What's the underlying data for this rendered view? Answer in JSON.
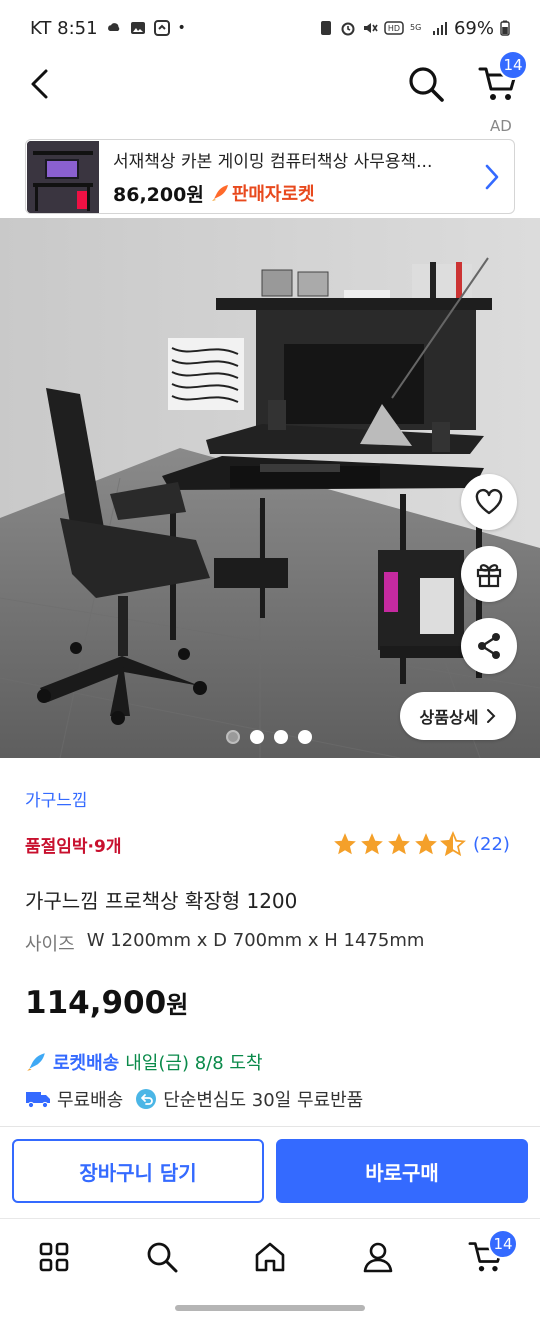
{
  "status_bar": {
    "carrier_time": "KT 8:51",
    "battery": "69%",
    "dot": "•"
  },
  "nav": {
    "cart_badge": "14",
    "icons": [
      "chevron-left-icon",
      "search-icon",
      "cart-icon"
    ]
  },
  "ad": {
    "label": "AD",
    "title": "서재책상 카본 게이밍 컴퓨터책상 사무용책...",
    "price": "86,200원",
    "seller_tag": "판매자로켓"
  },
  "hero": {
    "detail_button": "상품상세",
    "image_count": 4,
    "active_index": 0
  },
  "product": {
    "brand": "가구느낌",
    "stock_warning": "품절임박·9개",
    "rating_value": 4.5,
    "review_count": "(22)",
    "title": "가구느낌 프로책상 확장형 1200",
    "size_label": "사이즈",
    "size_value": "W 1200mm x D 700mm x H 1475mm",
    "price": "114,900",
    "price_unit": "원",
    "delivery_type": "로켓배송",
    "delivery_date": "내일(금) 8/8 도착",
    "free_shipping": "무료배송",
    "returns": "단순변심도 30일 무료반품"
  },
  "actions": {
    "add_to_cart": "장바구니 담기",
    "buy_now": "바로구매"
  },
  "bottom_nav": {
    "cart_badge": "14",
    "icons": [
      "category-grid-icon",
      "search-icon",
      "home-icon",
      "profile-icon",
      "cart-icon"
    ]
  },
  "colors": {
    "accent": "#346aff",
    "stock_red": "#c8102e",
    "delivery_green": "#0a8a4a",
    "star": "#f4a02a"
  }
}
